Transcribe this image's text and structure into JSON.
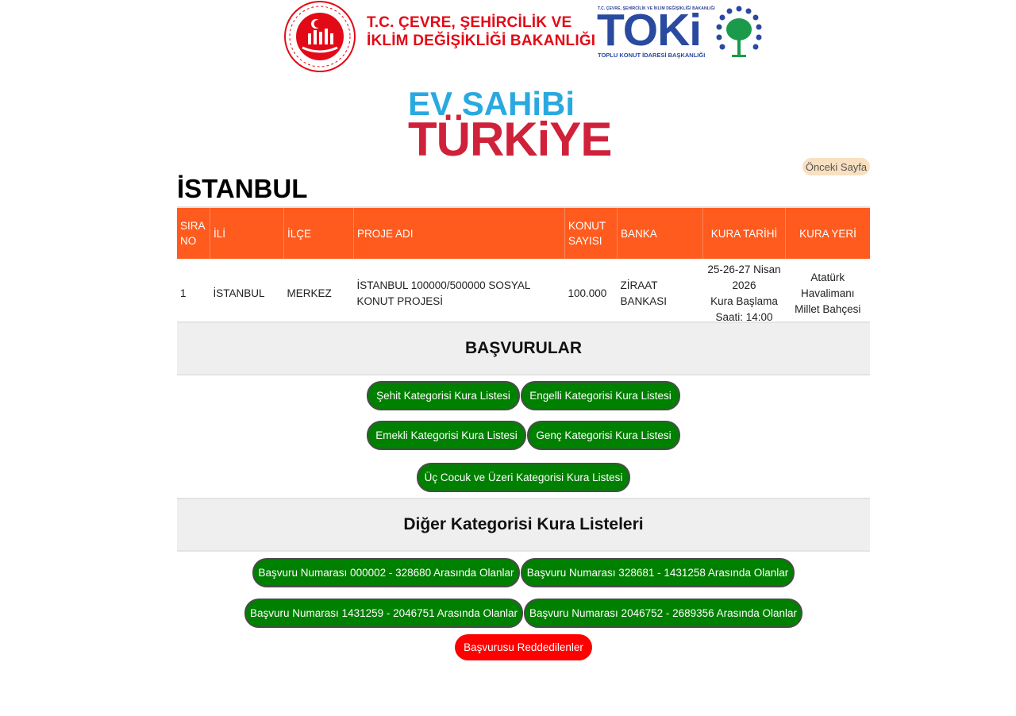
{
  "header": {
    "ministry_line1": "T.C. ÇEVRE, ŞEHİRCİLİK VE",
    "ministry_line2": "İKLİM DEĞİŞİKLİĞİ BAKANLIĞI",
    "toki_top": "T.C. ÇEVRE, ŞEHİRCİLİK VE İKLİM DEĞİŞİKLİĞİ BAKANLIĞI",
    "toki_word": "TOKi",
    "toki_sub": "TOPLU KONUT İDARESİ BAŞKANLIĞI"
  },
  "campaign": {
    "line1": "EV SAHiBi",
    "line2": "TÜRKiYE"
  },
  "nav": {
    "prev_label": "Önceki Sayfa"
  },
  "city_title": "İSTANBUL",
  "table": {
    "headers": [
      "SIRA NO",
      "İLİ",
      "İLÇE",
      "PROJE ADI",
      "KONUT SAYISI",
      "BANKA",
      "KURA TARİHİ",
      "KURA YERİ"
    ],
    "rows": [
      {
        "sira": "1",
        "il": "İSTANBUL",
        "ilce": "MERKEZ",
        "proje": "İSTANBUL  100000/500000 SOSYAL KONUT PROJESİ",
        "konut": "100.000",
        "banka": "ZİRAAT BANKASI",
        "tarih_line1": "25-26-27 Nisan 2026",
        "tarih_line2": "Kura Başlama Saati: 14:00",
        "yer": "Atatürk Havalimanı Millet Bahçesi"
      }
    ]
  },
  "basvurular": {
    "title": "BAŞVURULAR",
    "buttons": [
      "Şehit Kategorisi Kura Listesi",
      "Engelli Kategorisi Kura Listesi",
      "Emekli Kategorisi Kura Listesi",
      "Genç Kategorisi Kura Listesi",
      "Üç Cocuk ve Üzeri Kategorisi Kura Listesi"
    ]
  },
  "diger": {
    "title": "Diğer Kategorisi Kura Listeleri",
    "buttons": [
      "Başvuru Numarası 000002 - 328680 Arasında Olanlar",
      "Başvuru Numarası 328681 - 1431258 Arasında Olanlar",
      "Başvuru Numarası 1431259 - 2046751 Arasında Olanlar",
      "Başvuru Numarası 2046752 - 2689356 Arasında Olanlar"
    ],
    "rejected": "Başvurusu Reddedilenler"
  },
  "colors": {
    "table_header": "#ff5b1f",
    "button_green": "#008000",
    "button_red": "#ff0000",
    "ministry_red": "#e30a17",
    "toki_blue": "#2a4a9f",
    "campaign_blue": "#29a9df",
    "campaign_red": "#d0213a"
  }
}
